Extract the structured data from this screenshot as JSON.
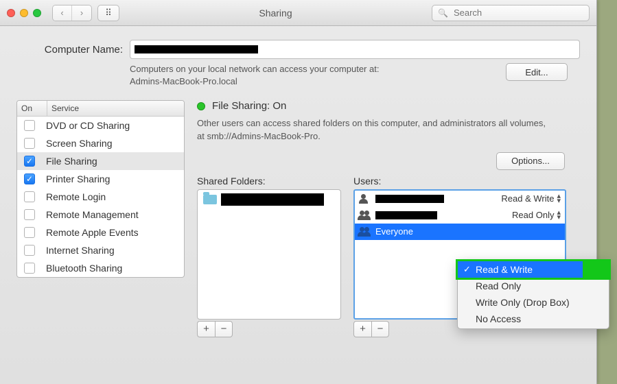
{
  "titlebar": {
    "title": "Sharing",
    "search_placeholder": "Search"
  },
  "computer_name": {
    "label": "Computer Name:",
    "value_redacted": true,
    "subtext_line1": "Computers on your local network can access your computer at:",
    "subtext_line2": "Admins-MacBook-Pro.local",
    "edit_button": "Edit..."
  },
  "services": {
    "header_on": "On",
    "header_service": "Service",
    "items": [
      {
        "label": "DVD or CD Sharing",
        "checked": false,
        "selected": false
      },
      {
        "label": "Screen Sharing",
        "checked": false,
        "selected": false
      },
      {
        "label": "File Sharing",
        "checked": true,
        "selected": true
      },
      {
        "label": "Printer Sharing",
        "checked": true,
        "selected": false
      },
      {
        "label": "Remote Login",
        "checked": false,
        "selected": false
      },
      {
        "label": "Remote Management",
        "checked": false,
        "selected": false
      },
      {
        "label": "Remote Apple Events",
        "checked": false,
        "selected": false
      },
      {
        "label": "Internet Sharing",
        "checked": false,
        "selected": false
      },
      {
        "label": "Bluetooth Sharing",
        "checked": false,
        "selected": false
      }
    ]
  },
  "file_sharing": {
    "status_label": "File Sharing: On",
    "status_color": "#2bc52b",
    "description": "Other users can access shared folders on this computer, and administrators all volumes, at smb://Admins-MacBook-Pro.",
    "options_button": "Options...",
    "shared_folders_label": "Shared Folders:",
    "users_label": "Users:",
    "shared_folders": [
      {
        "name_redacted": true
      }
    ],
    "users": [
      {
        "name_redacted": true,
        "icon": "single",
        "permission": "Read & Write",
        "selected": false
      },
      {
        "name_redacted": true,
        "icon": "pair",
        "permission": "Read Only",
        "selected": false
      },
      {
        "name": "Everyone",
        "icon": "pair",
        "permission": "",
        "selected": true
      }
    ]
  },
  "permission_menu": {
    "items": [
      {
        "label": "Read & Write",
        "checked": true,
        "highlighted": true
      },
      {
        "label": "Read Only",
        "checked": false,
        "highlighted": false
      },
      {
        "label": "Write Only (Drop Box)",
        "checked": false,
        "highlighted": false
      },
      {
        "label": "No Access",
        "checked": false,
        "highlighted": false
      }
    ]
  },
  "glyphs": {
    "plus": "+",
    "minus": "−",
    "check": "✓",
    "up": "▴",
    "down": "▾",
    "left": "‹",
    "right": "›",
    "grid": "⠿",
    "search": "🔍"
  }
}
